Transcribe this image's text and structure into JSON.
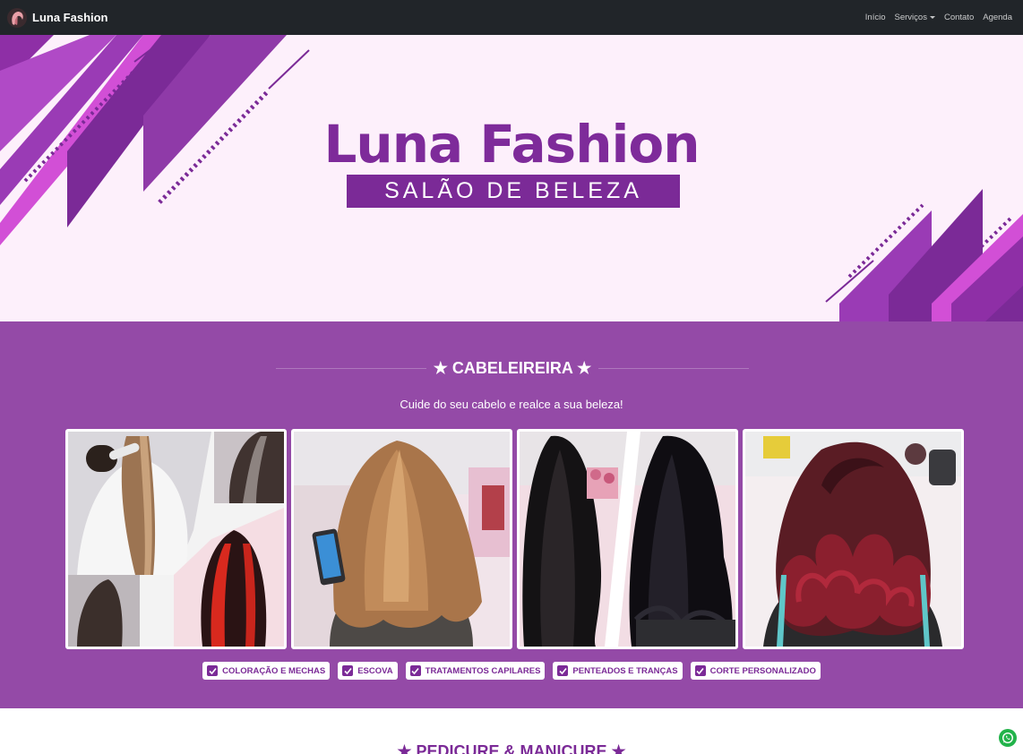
{
  "navbar": {
    "brand": "Luna Fashion",
    "links": [
      "Início",
      "Serviços",
      "Contato",
      "Agenda"
    ],
    "logo_icon": "hair-silhouette-icon"
  },
  "hero": {
    "title": "Luna Fashion",
    "subtitle": "SALÃO DE BELEZA",
    "colors": {
      "background": "#fdf0fb",
      "primary": "#7b2a97",
      "accent": "#d24fd6"
    }
  },
  "cabeleireira": {
    "title": "★ CABELEIREIRA ★",
    "description": "Cuide do seu cabelo e realce a sua beleza!",
    "background": "#944aa7",
    "photos": [
      "hair-coloring-collage-photo",
      "brown-straight-hair-photo",
      "black-hair-before-after-photo",
      "red-curly-hair-photo"
    ],
    "tags": [
      "COLORAÇÃO E MECHAS",
      "ESCOVA",
      "TRATAMENTOS CAPILARES",
      "PENTEADOS E TRANÇAS",
      "CORTE PERSONALIZADO"
    ]
  },
  "next_section": {
    "title": "★ PEDICURE & MANICURE ★"
  },
  "floating": {
    "whatsapp_icon": "whatsapp-icon"
  }
}
